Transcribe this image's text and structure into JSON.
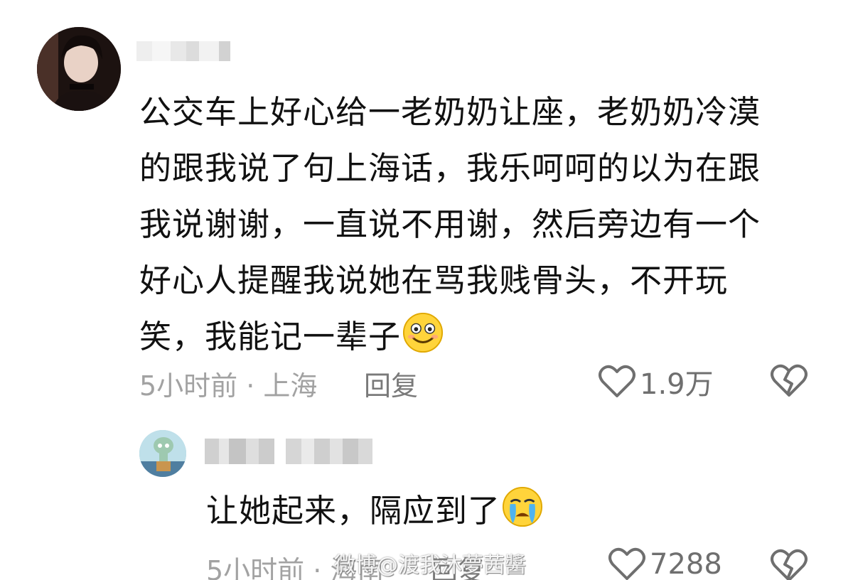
{
  "comment": {
    "lines": [
      "公交车上好心给一老奶奶让座，老奶奶冷漠",
      "的跟我说了句上海话，我乐呵呵的以为在跟",
      "我说谢谢，一直说不用谢，然后旁边有一个",
      "好心人提醒我说她在骂我贱骨头，不开玩",
      "笑，我能记一辈子"
    ],
    "emoji": "smile-emoji",
    "time_location": "5小时前 · 上海",
    "reply_label": "回复",
    "likes": "1.9万"
  },
  "reply": {
    "text": "让她起来，隔应到了",
    "emoji": "crying-emoji",
    "time_location": "5小时前 · 海南",
    "reply_label": "回复",
    "likes": "7288"
  },
  "watermark": "微博@渡我沐夢茜醬",
  "colors": {
    "text": "#111111",
    "meta": "#a2a2a2",
    "icon": "#6f6f6f"
  }
}
